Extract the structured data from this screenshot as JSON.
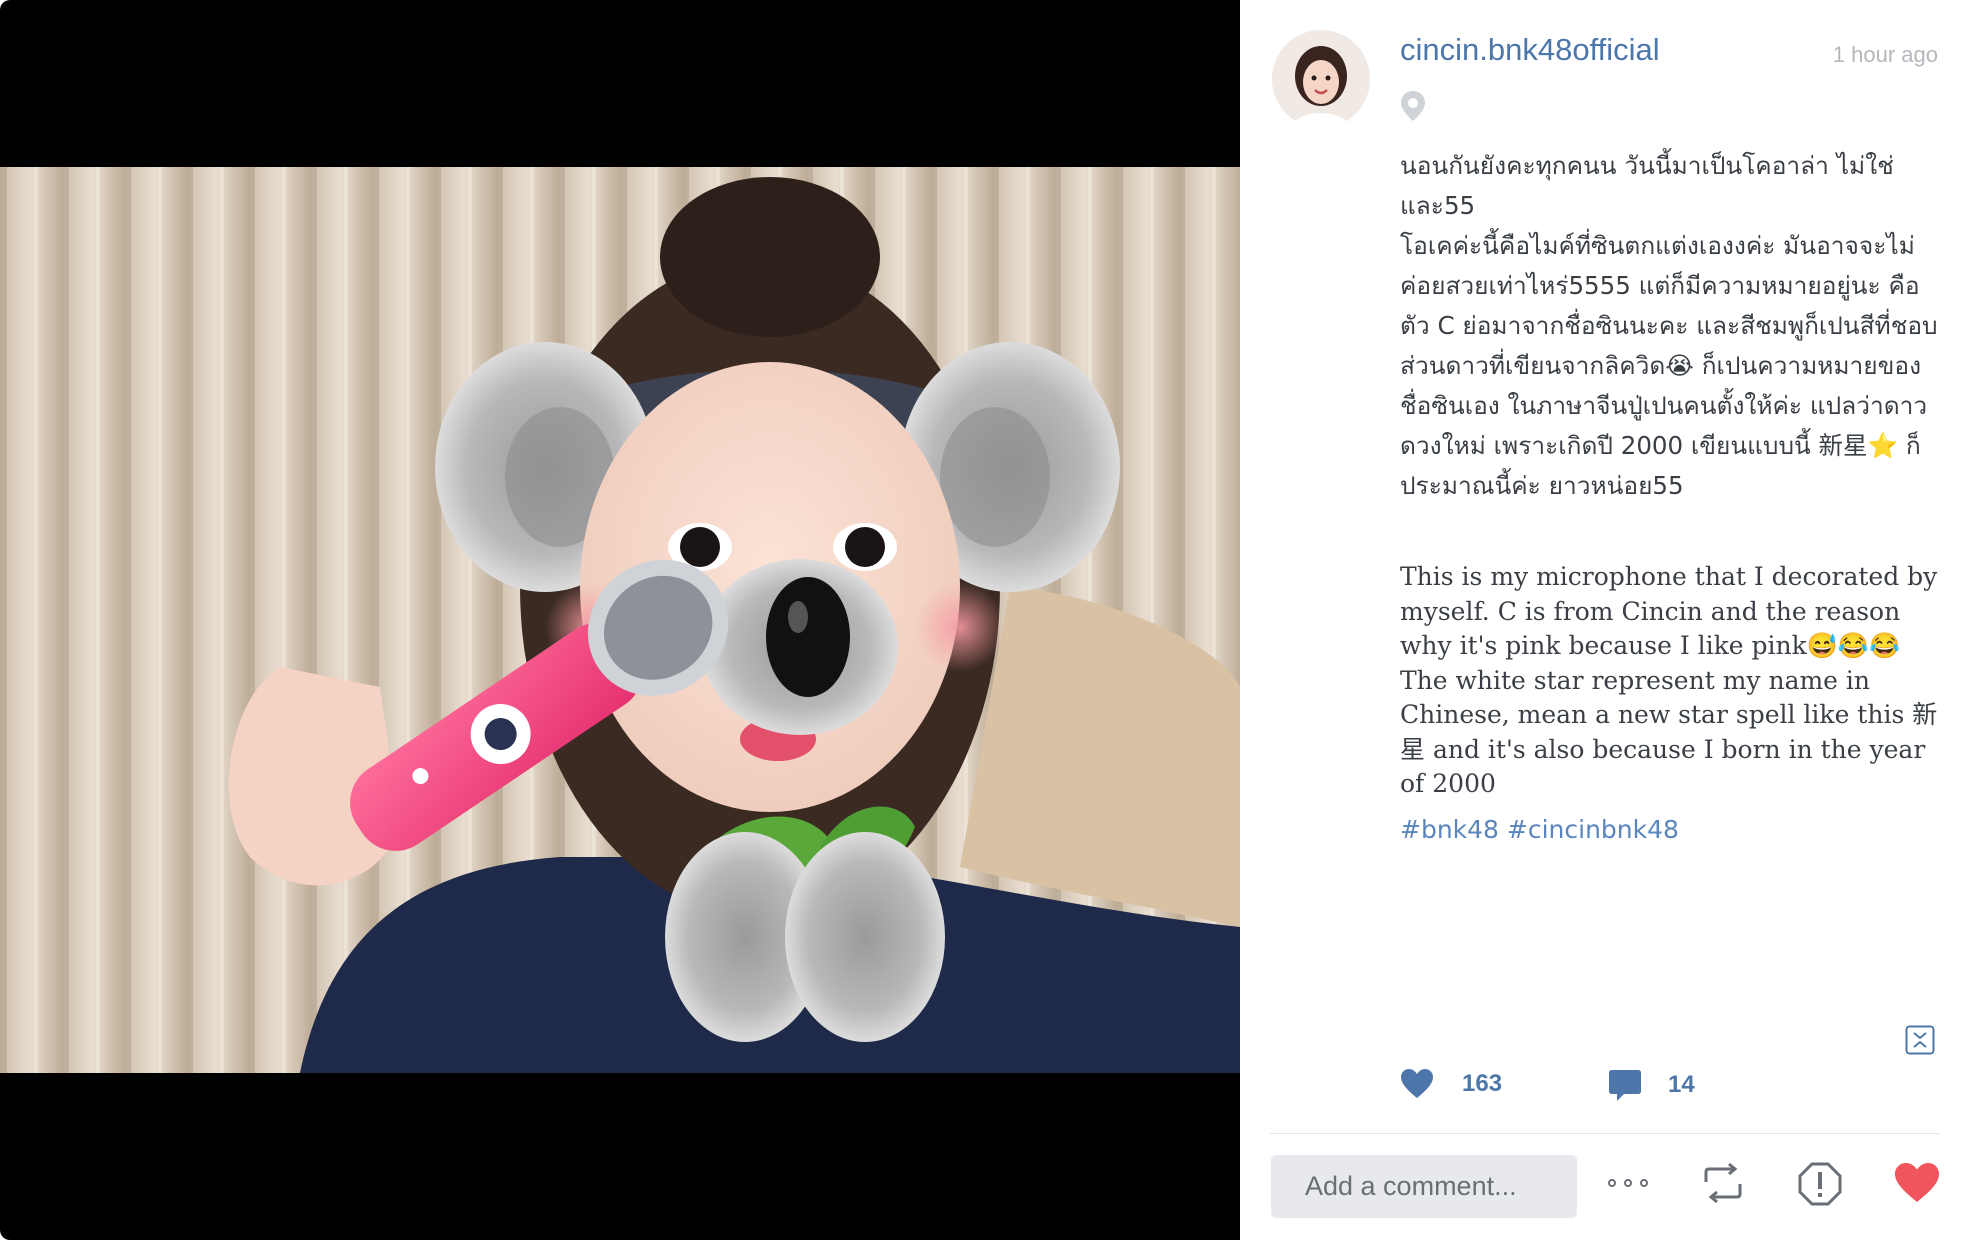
{
  "post": {
    "username": "cincin.bnk48official",
    "time": "1 hour ago",
    "caption_th": "นอนกันยังคะทุกคนน วันนี้มาเป็นโคอาล่า ไม่ใช่และ55\nโอเคค่ะนี้คือไมค์ที่ซินตกแต่งเองงค่ะ มันอาจจะไม่ค่อยสวยเท่าไหร่5555 แต่ก็มีความหมายอยู่นะ คือตัว C ย่อมาจากชื่อซินนะคะ และสีชมพูก็เปนสีที่ชอบ ส่วนดาวที่เขียนจากลิควิด😭 ก็เปนความหมายของชื่อซินเอง ในภาษาจีนปู่เปนคนตั้งให้ค่ะ แปลว่าดาวดวงใหม่ เพราะเกิดปี 2000 เขียนแบบนี้ 新星⭐️ ก็ประมาณนี้ค่ะ ยาวหน่อย55",
    "caption_en": "This is my microphone that I decorated by myself. C is from Cincin and the reason why it's pink because I like pink😅😂😂 The white star represent my name in Chinese, mean a new star spell like this 新星 and it's also because I born in the year of 2000",
    "hashtags": [
      "#bnk48",
      "#cincinbnk48"
    ],
    "likes": "163",
    "comments": "14"
  },
  "comment": {
    "placeholder": "Add a comment..."
  },
  "icons": {
    "location": "location-pin-icon",
    "collapse": "collapse-icon",
    "like": "heart-icon",
    "comment": "comment-bubble-icon",
    "more": "more-dots-icon",
    "repost": "repost-icon",
    "report": "report-icon",
    "favorite": "favorite-heart-icon"
  },
  "colors": {
    "accent": "#4d76aa",
    "hashtag": "#5b86bd",
    "favorite": "#f0545c",
    "muted": "#b4b8bd"
  }
}
